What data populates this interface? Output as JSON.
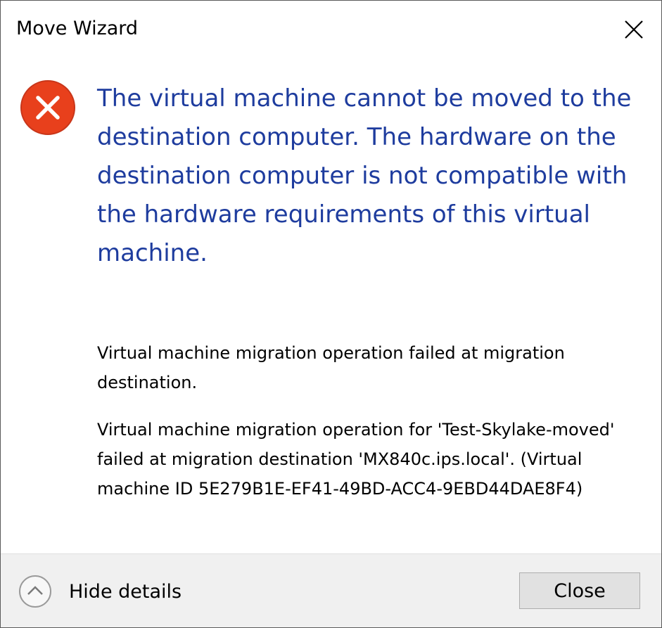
{
  "window": {
    "title": "Move Wizard",
    "close_icon": "close-icon"
  },
  "message": {
    "icon": "error-icon",
    "main_instruction": "The virtual machine cannot be moved to the destination computer. The hardware on the destination computer is not compatible with the hardware requirements of this virtual machine.",
    "details": [
      "Virtual machine migration operation failed at migration destination.",
      "Virtual machine migration operation for 'Test-Skylake-moved' failed at migration destination 'MX840c.ips.local'. (Virtual machine ID 5E279B1E-EF41-49BD-ACC4-9EBD44DAE8F4)"
    ]
  },
  "footer": {
    "toggle_icon": "chevron-up-icon",
    "toggle_label": "Hide details",
    "close_label": "Close"
  },
  "colors": {
    "main_instruction": "#1e3c9e",
    "error_icon": "#e8401c",
    "footer_background": "#f0f0f0"
  }
}
